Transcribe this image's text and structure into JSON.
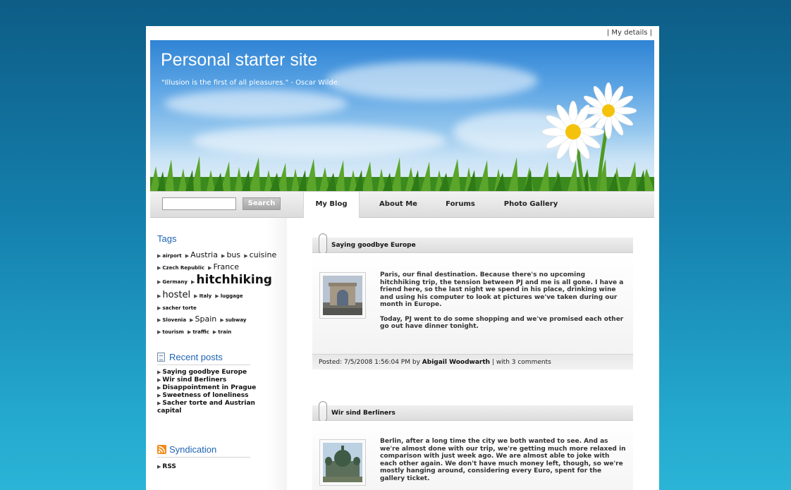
{
  "topbar": {
    "details_link": "My details",
    "sep": "|"
  },
  "header": {
    "title": "Personal starter site",
    "quote": "\"Illusion is the first of all pleasures.\" - Oscar Wilde."
  },
  "search": {
    "button_label": "Search",
    "value": ""
  },
  "nav": {
    "tabs": [
      {
        "label": "My Blog"
      },
      {
        "label": "About Me"
      },
      {
        "label": "Forums"
      },
      {
        "label": "Photo Gallery"
      }
    ]
  },
  "sidebar": {
    "tags_heading": "Tags",
    "tags": [
      {
        "label": "airport"
      },
      {
        "label": "Austria"
      },
      {
        "label": "bus"
      },
      {
        "label": "cuisine"
      },
      {
        "label": "Czech Republic"
      },
      {
        "label": "France"
      },
      {
        "label": "Germany"
      },
      {
        "label": "hitchhiking"
      },
      {
        "label": "hostel"
      },
      {
        "label": "Italy"
      },
      {
        "label": "luggage"
      },
      {
        "label": "sacher torte"
      },
      {
        "label": "Slovenia"
      },
      {
        "label": "Spain"
      },
      {
        "label": "subway"
      },
      {
        "label": "tourism"
      },
      {
        "label": "traffic"
      },
      {
        "label": "train"
      }
    ],
    "recent_heading": "Recent posts",
    "recent": [
      "Saying goodbye Europe",
      "Wir sind Berliners",
      "Disappointment in Prague",
      "Sweetness of loneliness",
      "Sacher torte and Austrian",
      "capital"
    ],
    "synd_heading": "Syndication",
    "synd_items": [
      "RSS"
    ]
  },
  "posts": [
    {
      "title": "Saying goodbye Europe",
      "para1": "Paris, our final destination. Because there's no upcoming hitchhiking trip, the tension between PJ and me is all gone. I have a friend here, so the last night we spend in his place, drinking wine and using his computer to look at pictures we've taken during our month in Europe.",
      "para2": "Today, PJ went to do some shopping and we've promised each other go out have dinner tonight.",
      "footer_prefix": "Posted: 7/5/2008 1:56:04 PM by",
      "author": "Abigail Woodwarth",
      "footer_suffix": "| with 3 comments"
    },
    {
      "title": "Wir sind Berliners",
      "para1": "Berlin, after a long time the city we both wanted to see. And as we're almost done with our trip, we're getting much more relaxed in comparison with just week ago. We are almost able to joke with each other again. We don't have much money left, though, so we're mostly hanging around, considering every Euro, spent for the gallery ticket."
    }
  ]
}
